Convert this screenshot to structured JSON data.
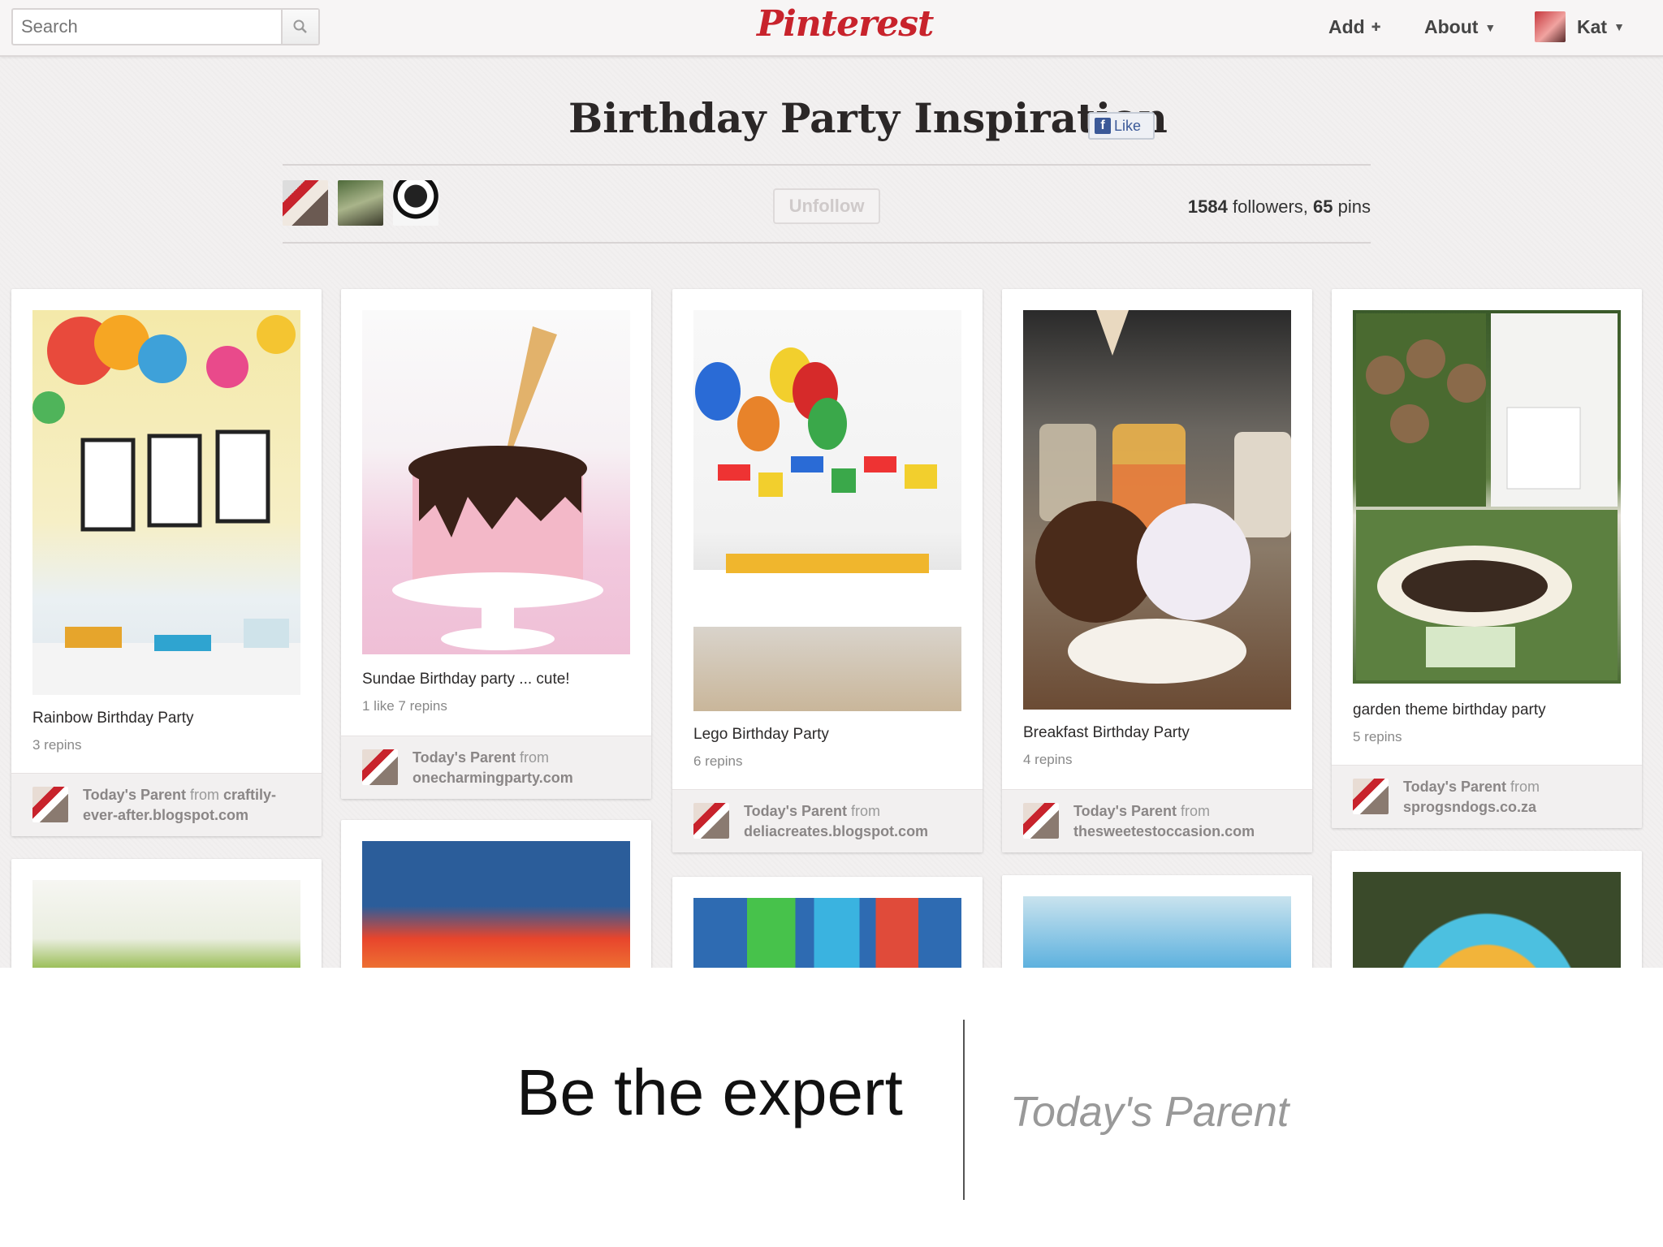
{
  "header": {
    "search_placeholder": "Search",
    "logo_text": "Pinterest",
    "nav": {
      "add": "Add",
      "about": "About",
      "user": "Kat"
    }
  },
  "board": {
    "title": "Birthday Party Inspiration",
    "like_label": "Like",
    "unfollow_label": "Unfollow",
    "followers_count": "1584",
    "followers_label": "followers,",
    "pins_count": "65",
    "pins_label": "pins"
  },
  "pins": [
    {
      "desc": "Rainbow Birthday Party",
      "repins": "3 repins",
      "by": "Today's Parent",
      "from": "from",
      "source": "craftily-ever-after.blogspot.com"
    },
    {
      "desc": "Sundae Birthday party ... cute!",
      "repins": "1 like  7 repins",
      "by": "Today's Parent",
      "from": "from",
      "source": "onecharmingparty.com"
    },
    {
      "desc": "Lego Birthday Party",
      "repins": "6 repins",
      "by": "Today's Parent",
      "from": "from",
      "source": "deliacreates.blogspot.com"
    },
    {
      "desc": "Breakfast Birthday Party",
      "repins": "4 repins",
      "by": "Today's Parent",
      "from": "from",
      "source": "thesweetestoccasion.com"
    },
    {
      "desc": "garden theme birthday party",
      "repins": "5 repins",
      "by": "Today's Parent",
      "from": "from",
      "source": "sprogsndogs.co.za"
    }
  ],
  "slide": {
    "tagline": "Be the expert",
    "byline": "Today's Parent"
  }
}
